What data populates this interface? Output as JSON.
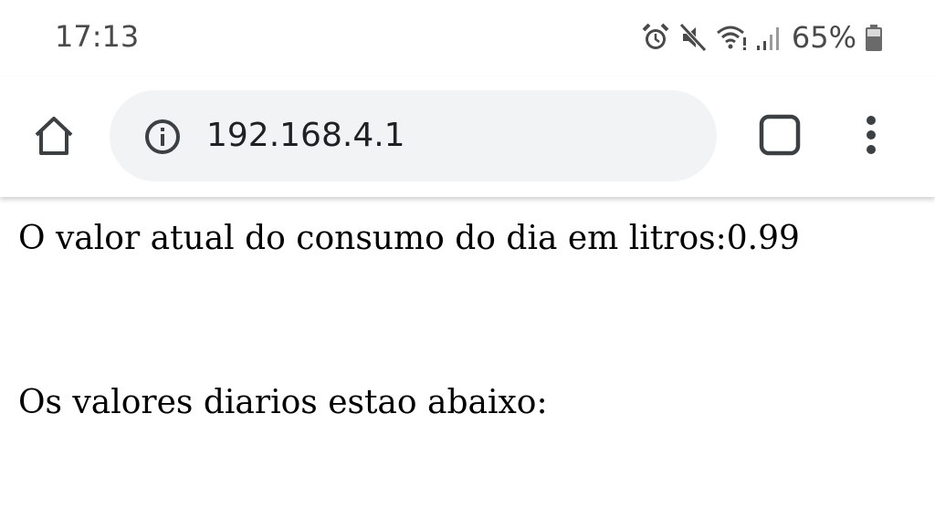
{
  "status_bar": {
    "time": "17:13",
    "battery_percent": "65%",
    "icons": [
      "alarm-icon",
      "mute-icon",
      "wifi-icon",
      "signal-icon",
      "battery-icon"
    ]
  },
  "toolbar": {
    "url": "192.168.4.1",
    "icons": [
      "home-icon",
      "info-icon",
      "tabs-icon",
      "more-vert-icon"
    ]
  },
  "page": {
    "current_label": "O valor atual do consumo do dia em litros:",
    "current_value": "0.99",
    "daily_heading": "Os valores diarios estao abaixo:"
  },
  "colors": {
    "status_text": "#4a4a4a",
    "omnibox_bg": "#f1f3f4",
    "icon": "#3c4043"
  }
}
